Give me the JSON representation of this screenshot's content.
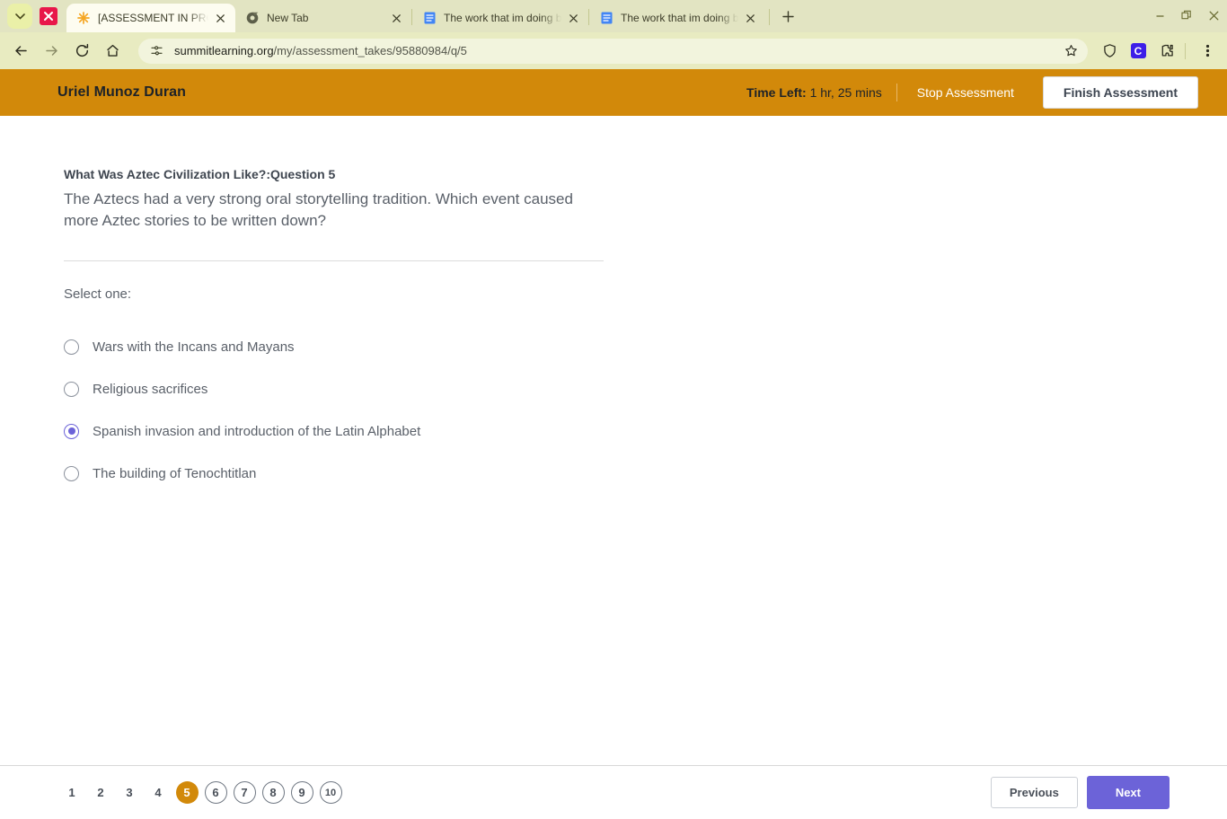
{
  "browser": {
    "tabs": [
      {
        "title": "[ASSESSMENT IN PROGRESS] S",
        "favicon": "sun-asterisk-icon",
        "active": true
      },
      {
        "title": "New Tab",
        "favicon": "chrome-icon",
        "active": false
      },
      {
        "title": "The work that im doing becaus",
        "favicon": "google-docs-icon",
        "active": false
      },
      {
        "title": "The work that im doing becaus",
        "favicon": "google-docs-icon",
        "active": false
      }
    ],
    "new_tab_label": "+",
    "window_controls": {
      "minimize": "–",
      "maximize": "❐",
      "close": "✕"
    },
    "toolbar": {
      "back": "back-arrow-icon",
      "forward": "forward-arrow-icon",
      "reload": "reload-icon",
      "home": "home-icon",
      "url_prefix": "summitlearning.org",
      "url_suffix": "/my/assessment_takes/95880984/q/5",
      "site_info": "site-settings-icon",
      "bookmark": "star-icon",
      "shield": "shield-icon",
      "extension_c": "C",
      "extensions": "puzzle-piece-icon",
      "menu": "three-dot-menu-icon"
    },
    "extension_badge": "✖"
  },
  "header": {
    "student_name": "Uriel Munoz Duran",
    "time_left_label": "Time Left:",
    "time_left_value": " 1 hr, 25 mins",
    "stop_label": "Stop Assessment",
    "finish_label": "Finish Assessment",
    "background_color": "#d2890a"
  },
  "question": {
    "title": "What Was Aztec Civilization Like?:Question 5",
    "body": "The Aztecs had a very strong oral storytelling tradition. Which event caused more Aztec stories to be written down?",
    "select_prompt": "Select one:",
    "options": [
      {
        "label": "Wars with the Incans and Mayans",
        "selected": false
      },
      {
        "label": "Religious sacrifices",
        "selected": false
      },
      {
        "label": "Spanish invasion and introduction of the Latin Alphabet",
        "selected": true
      },
      {
        "label": "The building of Tenochtitlan",
        "selected": false
      }
    ],
    "selected_color": "#6c63d8"
  },
  "footer": {
    "pages": [
      {
        "label": "1",
        "state": "plain"
      },
      {
        "label": "2",
        "state": "plain"
      },
      {
        "label": "3",
        "state": "plain"
      },
      {
        "label": "4",
        "state": "plain"
      },
      {
        "label": "5",
        "state": "current"
      },
      {
        "label": "6",
        "state": "ring"
      },
      {
        "label": "7",
        "state": "ring"
      },
      {
        "label": "8",
        "state": "ring"
      },
      {
        "label": "9",
        "state": "ring"
      },
      {
        "label": "10",
        "state": "ring"
      }
    ],
    "previous_label": "Previous",
    "next_label": "Next",
    "next_color": "#6c63d8"
  }
}
